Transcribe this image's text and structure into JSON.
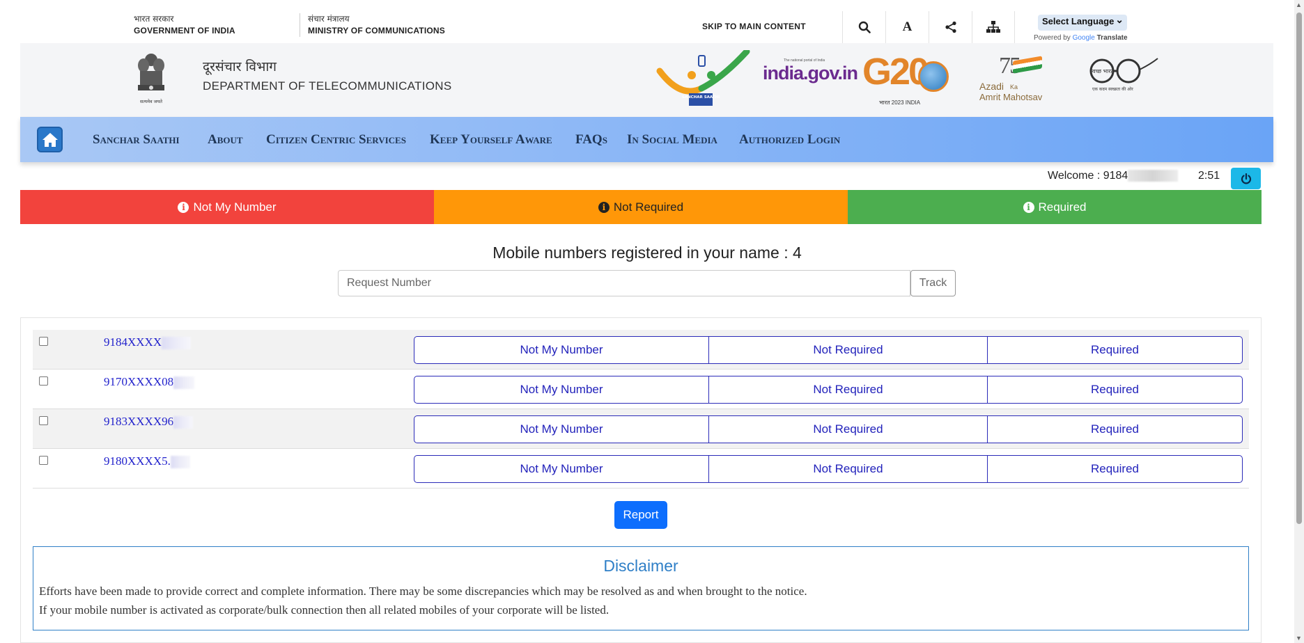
{
  "gov_bar": {
    "gov_hi": "भारत सरकार",
    "gov_en": "GOVERNMENT OF INDIA",
    "ministry_hi": "संचार मंत्रालय",
    "ministry_en": "MINISTRY OF COMMUNICATIONS",
    "skip_link": "SKIP TO MAIN CONTENT",
    "font_size_btn": "A",
    "language_select": "Select Language",
    "powered_by": "Powered by",
    "google": "Google",
    "translate": "Translate"
  },
  "header": {
    "emblem_caption": "सत्यमेव जयते",
    "dept_hi": "दूरसंचार विभाग",
    "dept_en": "DEPARTMENT OF TELECOMMUNICATIONS",
    "logos": {
      "sanchar_saathi": "SANCHAR SAATHI",
      "india_gov": "india.gov.in",
      "india_gov_tag": "The national portal of India",
      "g20": "G20",
      "g20_sub": "भारत 2023 INDIA",
      "azadi_75": "75",
      "azadi_1": "Azadi",
      "azadi_ka": "Ka",
      "azadi_2": "Amrit Mahotsav",
      "swachh": "स्वच्छ भारत",
      "swachh_sub": "एक कदम स्वच्छता की ओर"
    }
  },
  "nav": {
    "items": [
      "Sanchar Saathi",
      "About",
      "Citizen Centric Services",
      "Keep Yourself Aware",
      "FAQs",
      "In Social Media",
      "Authorized Login"
    ]
  },
  "session": {
    "welcome": "Welcome : 9184",
    "timer": "2:51"
  },
  "status_legend": [
    {
      "label": "Not My Number",
      "color": "#f2433d"
    },
    {
      "label": "Not Required",
      "color": "#ff9708"
    },
    {
      "label": "Required",
      "color": "#4cae4f"
    }
  ],
  "main": {
    "registered_title": "Mobile numbers registered in your name : 4",
    "request_placeholder": "Request Number",
    "track_label": "Track",
    "numbers": [
      {
        "number": "9184XXXX",
        "checked": false
      },
      {
        "number": "9170XXXX08",
        "checked": false
      },
      {
        "number": "9183XXXX96",
        "checked": false
      },
      {
        "number": "9180XXXX5.",
        "checked": false
      }
    ],
    "options": [
      "Not My Number",
      "Not Required",
      "Required"
    ],
    "report_label": "Report"
  },
  "disclaimer": {
    "title": "Disclaimer",
    "line1": "Efforts have been made to provide correct and complete information. There may be some discrepancies which may be resolved as and when brought to the notice.",
    "line2": "If your mobile number is activated as corporate/bulk connection then all related mobiles of your corporate will be listed."
  }
}
